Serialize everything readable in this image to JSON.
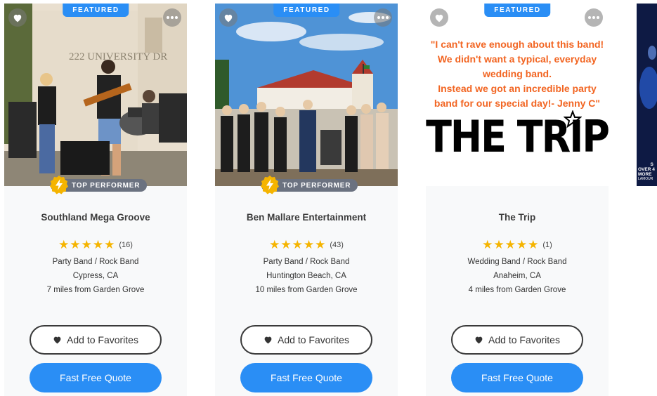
{
  "cards": [
    {
      "featured": "FEATURED",
      "badge": "TOP PERFORMER",
      "name": "Southland Mega Groove",
      "stars": "★★★★★",
      "reviews": "(16)",
      "category": "Party Band / Rock Band",
      "location": "Cypress, CA",
      "distance": "7 miles from Garden Grove",
      "photo_text": "222 UNIVERSITY DR",
      "fav_label": "Add to Favorites",
      "quote_label": "Fast Free Quote"
    },
    {
      "featured": "FEATURED",
      "badge": "TOP PERFORMER",
      "name": "Ben Mallare Entertainment",
      "stars": "★★★★★",
      "reviews": "(43)",
      "category": "Party Band / Rock Band",
      "location": "Huntington Beach, CA",
      "distance": "10 miles from Garden Grove",
      "fav_label": "Add to Favorites",
      "quote_label": "Fast Free Quote"
    },
    {
      "featured": "FEATURED",
      "name": "The Trip",
      "stars": "★★★★★",
      "reviews": "(1)",
      "category": "Wedding Band / Rock Band",
      "location": "Anaheim, CA",
      "distance": "4 miles from Garden Grove",
      "quote_lines": [
        "\"I can't rave enough about this band!",
        "We didn't want a typical, everyday",
        "wedding band.",
        "Instead we got an incredible party",
        "band for our special day!- Jenny C\""
      ],
      "logo_text": "THE TRIP",
      "fav_label": "Add to Favorites",
      "quote_label": "Fast Free Quote"
    }
  ],
  "partial_card_text": [
    "S",
    "OVER 4",
    "MORE",
    "LAMOUR"
  ],
  "colors": {
    "accent": "#2a8ef5",
    "star": "#f5b400",
    "quote_orange": "#f26522",
    "badge_gray": "#6b7280"
  },
  "icons": [
    "heart-icon",
    "more-icon",
    "lightning-icon",
    "star-icon"
  ]
}
